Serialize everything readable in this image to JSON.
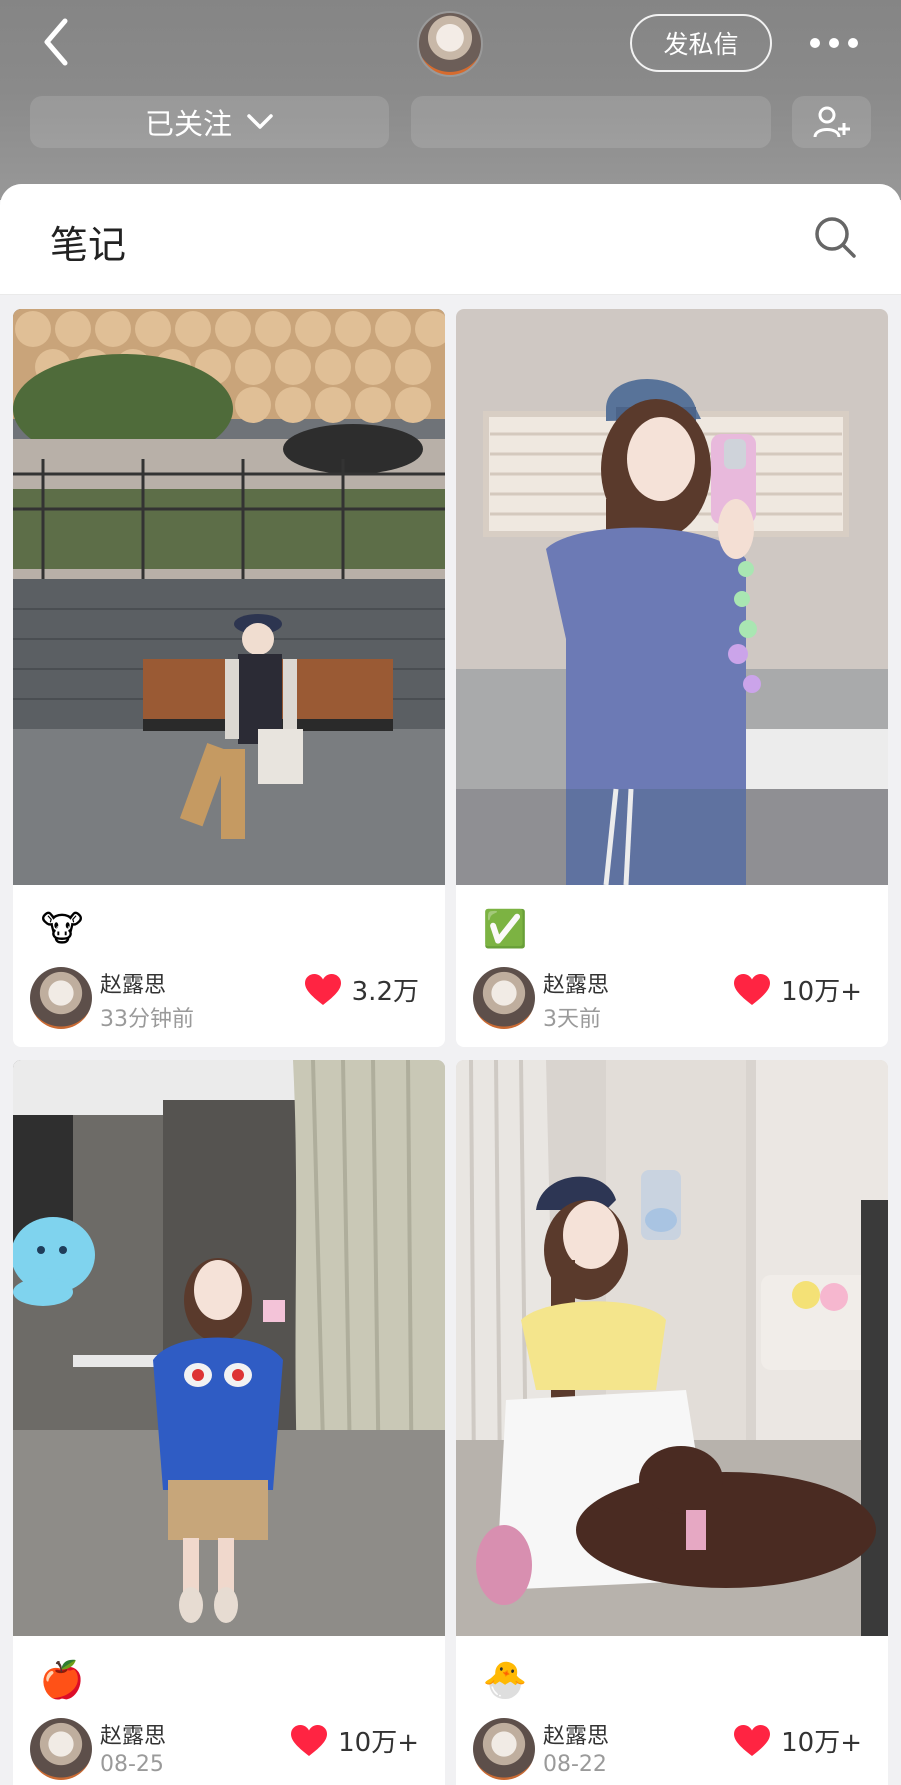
{
  "header": {
    "dm_label": "发私信",
    "follow_status": "已关注"
  },
  "notes": {
    "title": "笔记"
  },
  "colors": {
    "like_red": "#ff2442",
    "header_grey": "#8a8a8a"
  },
  "icons": {
    "back": "chevron-left-icon",
    "more": "more-dots-icon",
    "search": "search-icon",
    "add_friend": "add-user-icon",
    "like": "heart-icon"
  },
  "cards": [
    {
      "emoji": "🐮",
      "author": "赵露思",
      "time": "33分钟前",
      "likes": "3.2万"
    },
    {
      "emoji": "✅",
      "author": "赵露思",
      "time": "3天前",
      "likes": "10万+"
    },
    {
      "emoji": "🍎",
      "author": "赵露思",
      "time": "08-25",
      "likes": "10万+"
    },
    {
      "emoji": "🐣",
      "author": "赵露思",
      "time": "08-22",
      "likes": "10万+"
    }
  ]
}
